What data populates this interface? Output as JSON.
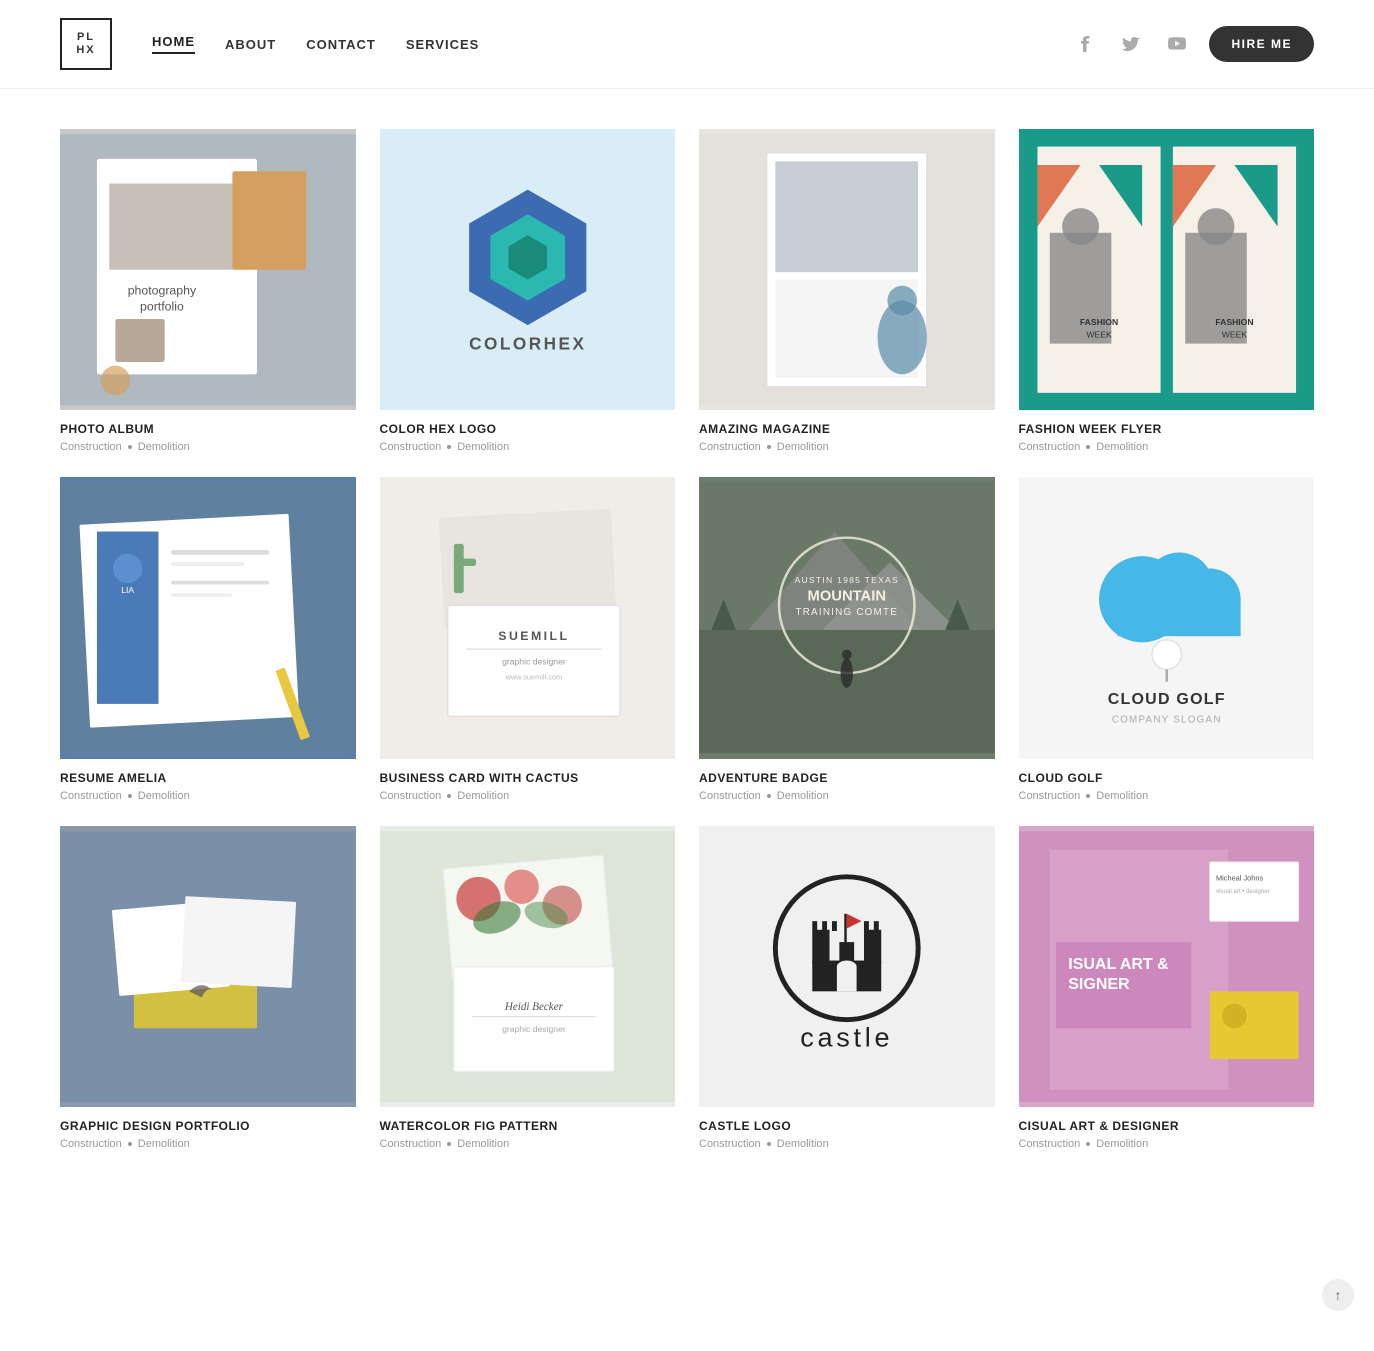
{
  "header": {
    "logo_line1": "PL",
    "logo_line2": "HX",
    "nav": [
      {
        "label": "HOME",
        "active": true
      },
      {
        "label": "ABOUT",
        "active": false
      },
      {
        "label": "CONTACT",
        "active": false
      },
      {
        "label": "SERVICES",
        "active": false
      }
    ],
    "hire_button": "HIRE ME"
  },
  "portfolio": {
    "items": [
      {
        "id": "photo-album",
        "title": "PHOTO ALBUM",
        "cat1": "Construction",
        "cat2": "Demolition",
        "bg": "bg-photo-album",
        "type": "photo-album"
      },
      {
        "id": "color-hex-logo",
        "title": "COLOR HEX LOGO",
        "cat1": "Construction",
        "cat2": "Demolition",
        "bg": "bg-color-hex",
        "type": "color-hex"
      },
      {
        "id": "amazing-magazine",
        "title": "AMAZING MAGAZINE",
        "cat1": "Construction",
        "cat2": "Demolition",
        "bg": "bg-amazing-mag",
        "type": "magazine"
      },
      {
        "id": "fashion-week-flyer",
        "title": "FASHION WEEK FLYER",
        "cat1": "Construction",
        "cat2": "Demolition",
        "bg": "bg-fashion-week",
        "type": "fashion"
      },
      {
        "id": "resume-amelia",
        "title": "RESUME AMELIA",
        "cat1": "Construction",
        "cat2": "Demolition",
        "bg": "bg-resume",
        "type": "resume"
      },
      {
        "id": "business-card-cactus",
        "title": "BUSINESS CARD WITH CACTUS",
        "cat1": "Construction",
        "cat2": "Demolition",
        "bg": "bg-business-card",
        "type": "business-card"
      },
      {
        "id": "adventure-badge",
        "title": "ADVENTURE BADGE",
        "cat1": "Construction",
        "cat2": "Demolition",
        "bg": "bg-adventure",
        "type": "adventure"
      },
      {
        "id": "cloud-golf",
        "title": "CLOUD GOLF",
        "cat1": "Construction",
        "cat2": "Demolition",
        "bg": "bg-cloud-golf",
        "type": "cloud-golf"
      },
      {
        "id": "graphic-design-portfolio",
        "title": "GRAPHIC DESIGN PORTFOLIO",
        "cat1": "Construction",
        "cat2": "Demolition",
        "bg": "bg-graphic-design",
        "type": "graphic-design"
      },
      {
        "id": "watercolor-fig-pattern",
        "title": "WATERCOLOR FIG PATTERN",
        "cat1": "Construction",
        "cat2": "Demolition",
        "bg": "bg-watercolor",
        "type": "watercolor"
      },
      {
        "id": "castle-logo",
        "title": "CASTLE LOGO",
        "cat1": "Construction",
        "cat2": "Demolition",
        "bg": "bg-castle",
        "type": "castle"
      },
      {
        "id": "cisual-art-designer",
        "title": "CISUAL ART & DESIGNER",
        "cat1": "Construction",
        "cat2": "Demolition",
        "bg": "bg-cisual",
        "type": "cisual"
      }
    ]
  }
}
